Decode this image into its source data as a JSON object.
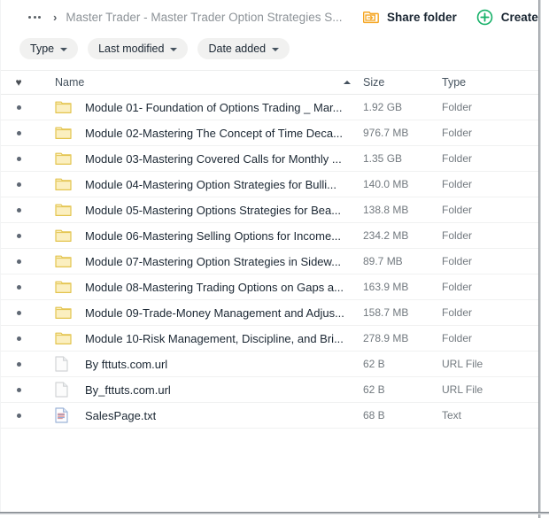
{
  "breadcrumb": {
    "overflow_label": "...",
    "separator": "›",
    "current": "Master Trader - Master Trader Option Strategies S..."
  },
  "toolbar": {
    "share_folder_label": "Share folder",
    "create_folder_label": "Create fol",
    "share_icon": "share-folder-icon",
    "create_icon": "plus-circle-icon"
  },
  "filters": [
    {
      "label": "Type",
      "icon": "chevron-down-icon"
    },
    {
      "label": "Last modified",
      "icon": "chevron-down-icon"
    },
    {
      "label": "Date added",
      "icon": "chevron-down-icon"
    }
  ],
  "table": {
    "headers": {
      "favorite": "♥",
      "name": "Name",
      "size": "Size",
      "type": "Type",
      "sort_direction": "ascending"
    },
    "rows": [
      {
        "marker": "•",
        "icon": "folder-icon",
        "name": "Module 01- Foundation of Options Trading _ Mar...",
        "size": "1.92 GB",
        "type": "Folder"
      },
      {
        "marker": "•",
        "icon": "folder-icon",
        "name": "Module 02-Mastering The Concept of Time Deca...",
        "size": "976.7 MB",
        "type": "Folder"
      },
      {
        "marker": "•",
        "icon": "folder-icon",
        "name": "Module 03-Mastering Covered Calls for Monthly ...",
        "size": "1.35 GB",
        "type": "Folder"
      },
      {
        "marker": "•",
        "icon": "folder-icon",
        "name": "Module 04-Mastering Option Strategies for Bulli...",
        "size": "140.0 MB",
        "type": "Folder"
      },
      {
        "marker": "•",
        "icon": "folder-icon",
        "name": "Module 05-Mastering Options Strategies for Bea...",
        "size": "138.8 MB",
        "type": "Folder"
      },
      {
        "marker": "•",
        "icon": "folder-icon",
        "name": "Module 06-Mastering Selling Options for Income...",
        "size": "234.2 MB",
        "type": "Folder"
      },
      {
        "marker": "•",
        "icon": "folder-icon",
        "name": "Module 07-Mastering Option Strategies in Sidew...",
        "size": "89.7 MB",
        "type": "Folder"
      },
      {
        "marker": "•",
        "icon": "folder-icon",
        "name": "Module 08-Mastering Trading Options on Gaps a...",
        "size": "163.9 MB",
        "type": "Folder"
      },
      {
        "marker": "•",
        "icon": "folder-icon",
        "name": "Module 09-Trade-Money Management and Adjus...",
        "size": "158.7 MB",
        "type": "Folder"
      },
      {
        "marker": "•",
        "icon": "folder-icon",
        "name": "Module 10-Risk Management, Discipline, and Bri...",
        "size": "278.9 MB",
        "type": "Folder"
      },
      {
        "marker": "•",
        "icon": "url-file-icon",
        "name": "By fttuts.com.url",
        "size": "62 B",
        "type": "URL File"
      },
      {
        "marker": "•",
        "icon": "url-file-icon",
        "name": "By_fttuts.com.url",
        "size": "62 B",
        "type": "URL File"
      },
      {
        "marker": "•",
        "icon": "text-file-icon",
        "name": "SalesPage.txt",
        "size": "68 B",
        "type": "Text"
      }
    ]
  },
  "colors": {
    "folder_fill": "#fbefc0",
    "folder_stroke": "#e3c44e",
    "share_icon": "#f5a623",
    "create_icon": "#17b169",
    "text_primary": "#1b2733",
    "text_secondary": "#72797f",
    "chip_bg": "#f1f1f0"
  }
}
